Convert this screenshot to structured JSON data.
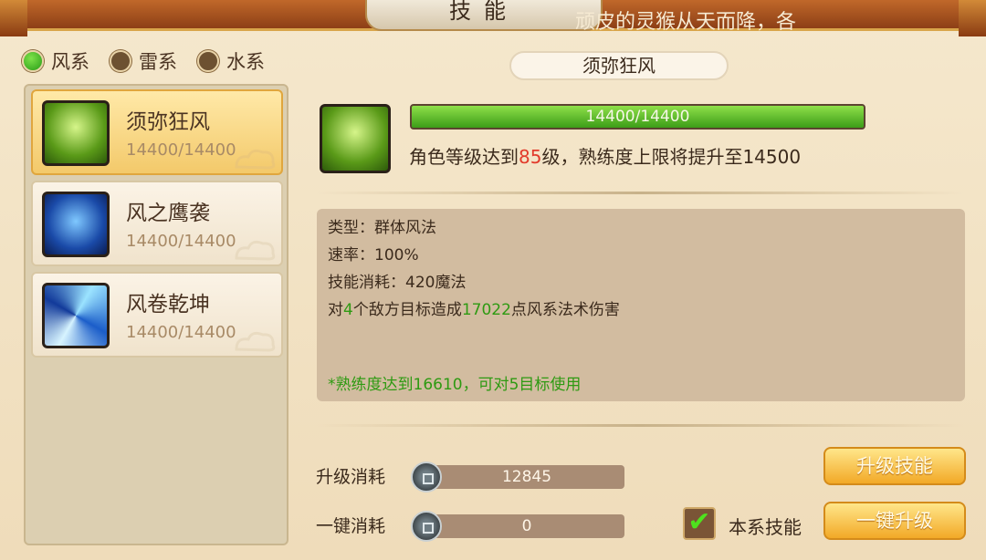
{
  "header": {
    "title": "技能",
    "marquee": "顽皮的灵猴从天而降，各"
  },
  "tabs": [
    {
      "label": "风系",
      "active": true
    },
    {
      "label": "雷系",
      "active": false
    },
    {
      "label": "水系",
      "active": false
    }
  ],
  "skills": [
    {
      "name": "须弥狂风",
      "proficiency": "14400/14400",
      "icon": "tornado-icon",
      "selected": true
    },
    {
      "name": "风之鹰袭",
      "proficiency": "14400/14400",
      "icon": "eagle-icon",
      "selected": false
    },
    {
      "name": "风卷乾坤",
      "proficiency": "14400/14400",
      "icon": "swirl-icon",
      "selected": false
    }
  ],
  "detail": {
    "name": "须弥狂风",
    "proficiency_text": "14400/14400",
    "proficiency_fraction": 1.0,
    "level_hint_prefix": "角色等级达到",
    "level_value": "85",
    "level_hint_suffix": "级，熟练度上限将提升至14500",
    "type_line": "类型：群体风法",
    "rate_line": "速率：100%",
    "cost_line": "技能消耗：420魔法",
    "effect_prefix": "对",
    "effect_targets": "4",
    "effect_middle": "个敌方目标造成",
    "effect_damage": "17022",
    "effect_suffix": "点风系法术伤害",
    "note": "*熟练度达到16610，可对5目标使用"
  },
  "costs": {
    "upgrade_label": "升级消耗",
    "upgrade_value": "12845",
    "onekey_label": "一键消耗",
    "onekey_value": "0"
  },
  "buttons": {
    "upgrade": "升级技能",
    "onekey": "一键升级"
  },
  "checkbox": {
    "label": "本系技能",
    "checked": true
  },
  "colors": {
    "active_tab": "#39b81c",
    "progress": "#5fc22a",
    "highlight_red": "#e23a2b",
    "highlight_green": "#2e9a12",
    "button": "#f2a927"
  }
}
